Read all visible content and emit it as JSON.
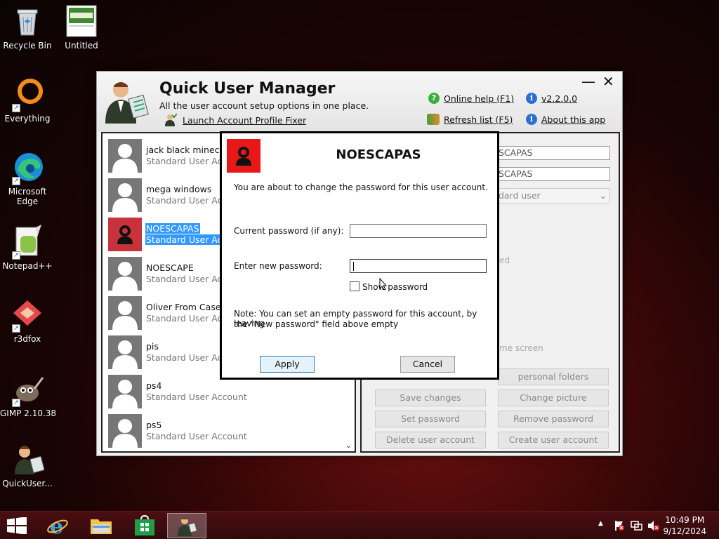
{
  "desktop": {
    "icons": [
      {
        "label": "Recycle Bin",
        "icon": "recycle-bin-icon"
      },
      {
        "label": "Untitled",
        "icon": "image-file-icon"
      },
      {
        "label": "Everything",
        "icon": "everything-icon"
      },
      {
        "label": "Microsoft Edge",
        "icon": "edge-icon"
      },
      {
        "label": "Notepad++",
        "icon": "notepadpp-icon"
      },
      {
        "label": "r3dfox",
        "icon": "r3dfox-icon"
      },
      {
        "label": "GIMP 2.10.38",
        "icon": "gimp-icon"
      },
      {
        "label": "QuickUser...",
        "icon": "quick-user-manager-icon"
      }
    ]
  },
  "app": {
    "title": "Quick User Manager",
    "subtitle": "All the user account setup options in one place.",
    "launch_link": "Launch Account Profile Fixer",
    "online_help": "Online help (F1)",
    "refresh_list": "Refresh list (F5)",
    "version": "v2.2.0.0",
    "about": "About this app",
    "minimize": "—",
    "close": "✕"
  },
  "users": [
    {
      "name": "jack black minecraft",
      "type": "Standard User Account",
      "selected": false
    },
    {
      "name": "mega windows",
      "type": "Standard User Account",
      "selected": false
    },
    {
      "name": "NOESCAPAS",
      "type": "Standard User Account",
      "selected": true
    },
    {
      "name": "NOESCAPE",
      "type": "Standard User Account",
      "selected": false
    },
    {
      "name": "Oliver From Caseoh",
      "type": "Standard User Account",
      "selected": false
    },
    {
      "name": "pis",
      "type": "Standard User Account",
      "selected": false
    },
    {
      "name": "ps4",
      "type": "Standard User Account",
      "selected": false
    },
    {
      "name": "ps5",
      "type": "Standard User Account",
      "selected": false
    }
  ],
  "right_panel": {
    "field1": "SCAPAS",
    "field2": "SCAPAS",
    "account_type": "dard user",
    "faded_ed": "ed",
    "faded_screen": "me screen",
    "personal_folders_btn": "personal folders",
    "save_changes": "Save changes",
    "change_picture": "Change picture",
    "set_password": "Set password",
    "remove_password": "Remove password",
    "delete_account": "Delete user account",
    "create_account": "Create user account"
  },
  "dialog": {
    "title": "NOESCAPAS",
    "message": "You are about to change the password for this user account.",
    "current_label": "Current password (if any):",
    "current_value": "",
    "new_label": "Enter new password:",
    "new_value": "",
    "show_password": "Show password",
    "note_line1": "Note: You can set an empty password for this account, by leaving",
    "note_line2": "the \"New password\" field above empty",
    "apply": "Apply",
    "cancel": "Cancel"
  },
  "taskbar": {
    "time": "10:49 PM",
    "date": "9/12/2024",
    "up_arrow": "▲"
  }
}
